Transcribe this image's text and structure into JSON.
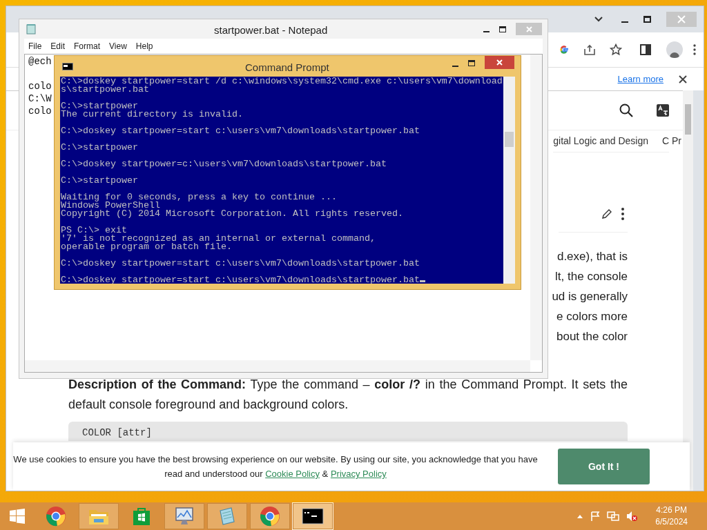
{
  "browser": {
    "info_bar": {
      "link": "Learn more"
    },
    "nav_items": [
      "gital Logic and Design",
      "C Pr"
    ],
    "paragraph_fragments": [
      "d.exe), that is",
      "lt, the console",
      "ud is generally",
      "e colors more",
      "bout the color"
    ],
    "description": "**Description of the Command:** Type the command – **color /?** in the Command Prompt. It sets the default console foreground and background colors.",
    "code": "COLOR [attr]",
    "cookie_banner": {
      "text": "We use cookies to ensure you have the best browsing experience on our website. By using our site, you acknowledge that you have read and understood our",
      "links": [
        "Cookie Policy",
        "Privacy Policy"
      ],
      "separator": "&",
      "button": "Got It !"
    }
  },
  "notepad": {
    "title": "startpower.bat - Notepad",
    "menu": [
      "File",
      "Edit",
      "Format",
      "View",
      "Help"
    ],
    "blocks": [
      [
        "@ech"
      ],
      [
        "colo",
        "C:\\W",
        "colo"
      ]
    ]
  },
  "command_prompt": {
    "title": "Command Prompt",
    "blocks": [
      [
        "C:\\>doskey startpower=start /d c:\\windows\\system32\\cmd.exe c:\\users\\vm7\\download",
        "s\\startpower.bat"
      ],
      [
        "C:\\>startpower",
        "The current directory is invalid."
      ],
      [
        "C:\\>doskey startpower=start c:\\users\\vm7\\downloads\\startpower.bat"
      ],
      [
        "C:\\>startpower"
      ],
      [
        "C:\\>doskey startpower=c:\\users\\vm7\\downloads\\startpower.bat"
      ],
      [
        "C:\\>startpower"
      ],
      [
        "Waiting for 0 seconds, press a key to continue ...",
        "Windows PowerShell",
        "Copyright (C) 2014 Microsoft Corporation. All rights reserved."
      ],
      [
        "PS C:\\> exit",
        "'7' is not recognized as an internal or external command,",
        "operable program or batch file."
      ],
      [
        "C:\\>doskey startpower=start c:\\users\\vm7\\downloads\\startpower.bat"
      ],
      [
        "C:\\>doskey startpower=start c:\\users\\vm7\\downloads\\startpower.bat"
      ]
    ]
  },
  "taskbar": {
    "items": [
      {
        "kind": "start",
        "running": false,
        "selected": false
      },
      {
        "kind": "chrome",
        "running": false,
        "selected": false
      },
      {
        "kind": "folder",
        "running": true,
        "selected": false
      },
      {
        "kind": "store",
        "running": false,
        "selected": false
      },
      {
        "kind": "monitor",
        "running": true,
        "selected": false
      },
      {
        "kind": "notepad",
        "running": true,
        "selected": false
      },
      {
        "kind": "chrome",
        "running": true,
        "selected": false
      },
      {
        "kind": "console",
        "running": true,
        "selected": true
      }
    ],
    "time": "4:26 PM",
    "date": "6/5/2024"
  }
}
